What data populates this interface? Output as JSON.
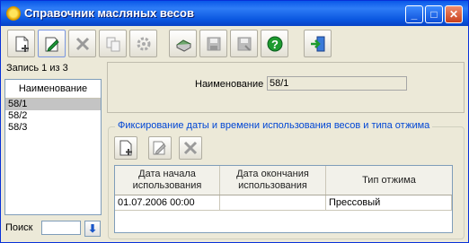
{
  "window": {
    "title": "Справочник масляных весов"
  },
  "titlebar_buttons": {
    "minimize": "_",
    "maximize": "□",
    "close": "✕"
  },
  "toolbar": {
    "items": [
      "new-document-icon",
      "edit-icon",
      "delete-icon",
      "copy-icon",
      "settings-icon",
      "print-icon",
      "save-icon",
      "save-all-icon",
      "help-icon",
      "exit-icon"
    ]
  },
  "record_status": "Запись 1 из 3",
  "list": {
    "header": "Наименование",
    "items": [
      "58/1",
      "58/2",
      "58/3"
    ],
    "selected_index": 0
  },
  "search": {
    "label": "Поиск",
    "value": "",
    "button_icon": "⬇"
  },
  "details": {
    "name_label": "Наименование",
    "name_value": "58/1"
  },
  "usage_group": {
    "title": "Фиксирование даты и времени использования весов и типа отжима",
    "columns": [
      "Дата начала использования",
      "Дата окончания использования",
      "Тип отжима"
    ],
    "rows": [
      [
        "01.07.2006 00:00",
        "",
        "Прессовый"
      ]
    ]
  },
  "colors": {
    "titlebar": "#0a58e8",
    "group_title": "#0046d5",
    "selection": "#c4c4c4"
  }
}
